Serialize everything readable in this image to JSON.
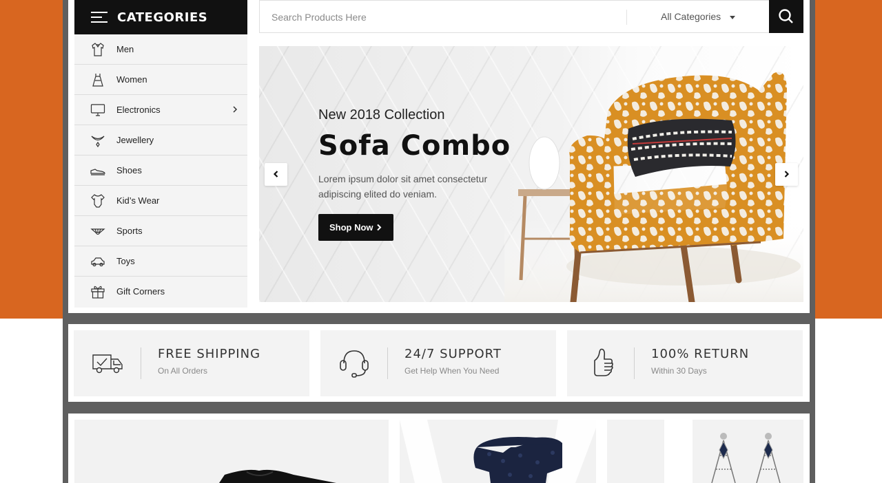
{
  "categories": {
    "header": "CATEGORIES",
    "items": [
      {
        "label": "Men",
        "icon": "shirt-icon"
      },
      {
        "label": "Women",
        "icon": "dress-icon"
      },
      {
        "label": "Electronics",
        "icon": "monitor-icon",
        "has_submenu": true
      },
      {
        "label": "Jewellery",
        "icon": "necklace-icon"
      },
      {
        "label": "Shoes",
        "icon": "shoe-icon"
      },
      {
        "label": "Kid’s Wear",
        "icon": "baby-onesie-icon"
      },
      {
        "label": "Sports",
        "icon": "shuttlecock-icon"
      },
      {
        "label": "Toys",
        "icon": "toy-car-icon"
      },
      {
        "label": "Gift Corners",
        "icon": "gift-icon"
      }
    ]
  },
  "search": {
    "placeholder": "Search Products Here",
    "category": "All Categories"
  },
  "slider": {
    "subtitle": "New 2018 Collection",
    "title": "Sofa Combo",
    "description": "Lorem ipsum dolor sit amet consectetur adipiscing elited do veniam.",
    "button": "Shop Now"
  },
  "features": [
    {
      "title": "FREE SHIPPING",
      "subtitle": "On All Orders",
      "icon": "delivery-truck-icon"
    },
    {
      "title": "24/7 SUPPORT",
      "subtitle": "Get Help When You Need",
      "icon": "headset-icon"
    },
    {
      "title": "100% RETURN",
      "subtitle": "Within 30 Days",
      "icon": "thumbs-up-icon"
    }
  ],
  "colors": {
    "accent": "#d86620",
    "dark": "#111111",
    "frame": "#5f5f5f"
  }
}
